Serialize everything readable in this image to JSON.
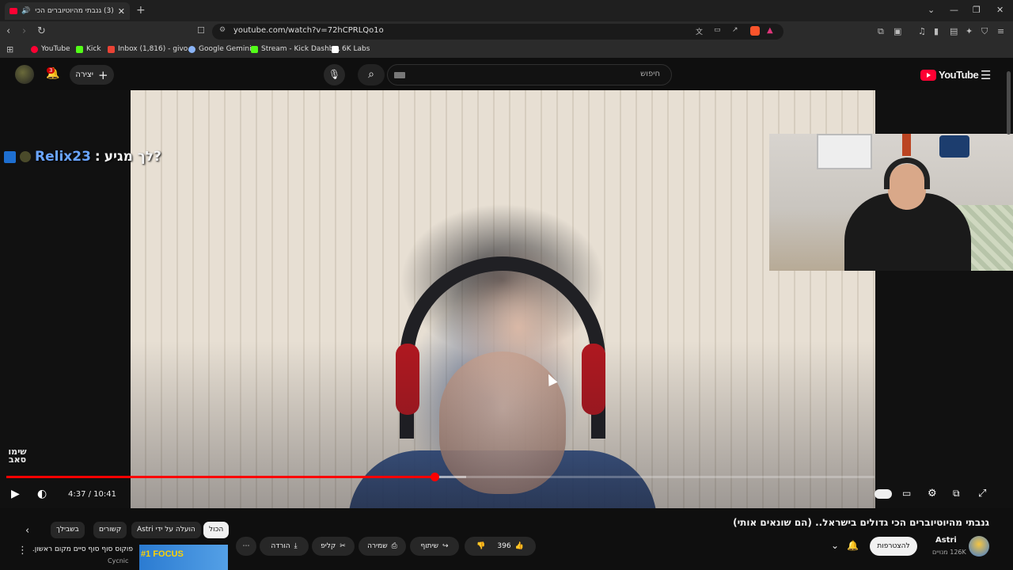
{
  "browser": {
    "tab_title": "(3) גנבתי מהיוטיוברים הכי גדו",
    "url": "youtube.com/watch?v=72hCPRLQo1o",
    "bookmarks": [
      {
        "label": "YouTube",
        "color": "#ff0033"
      },
      {
        "label": "Kick",
        "color": "#53fc18"
      },
      {
        "label": "Inbox (1,816) - givo...",
        "color": "#ea4335"
      },
      {
        "label": "Google Gemini",
        "color": "#8ab4f8"
      },
      {
        "label": "Stream - Kick Dashb...",
        "color": "#53fc18"
      },
      {
        "label": "6K Labs",
        "color": "#ffffff"
      }
    ]
  },
  "header": {
    "logo_text": "YouTube",
    "search_placeholder": "חיפוש",
    "create_label": "יצירה",
    "notification_count": "3"
  },
  "player": {
    "chat_user": "Relix23",
    "chat_separator": ":",
    "chat_message": "?לך מגיע",
    "watermark_text": "שימו סאב",
    "current_time": "4:37",
    "duration": "10:41",
    "time_display": "4:37 / 10:41",
    "played_fraction": 0.4929,
    "loaded_fraction": 0.53
  },
  "video": {
    "title": "גנבתי מהיוטיוברים הכי גדולים בישראל.. (הם שונאים אותי)",
    "channel_name": "Astri",
    "subscribers": "126K מנויים",
    "subscribe_label": "להצטרפות",
    "like_count": "396",
    "share_label": "שיתוף",
    "save_label": "שמירה",
    "clip_label": "קליפ",
    "download_label": "הורדה"
  },
  "chips": [
    {
      "label": "הכול",
      "active": true
    },
    {
      "label": "הועלה על ידי Astri",
      "active": false
    },
    {
      "label": "קשורים",
      "active": false
    },
    {
      "label": "בשבילך",
      "active": false
    }
  ],
  "recommendation": {
    "title": "פוקוס סוף סוף סיים מקום ראשון.",
    "channel": "Cycnic",
    "thumb_text": "#1 FOCUS"
  },
  "colors": {
    "accent": "#ff0000",
    "background": "#0f0f0f",
    "chip_bg": "#272727"
  }
}
